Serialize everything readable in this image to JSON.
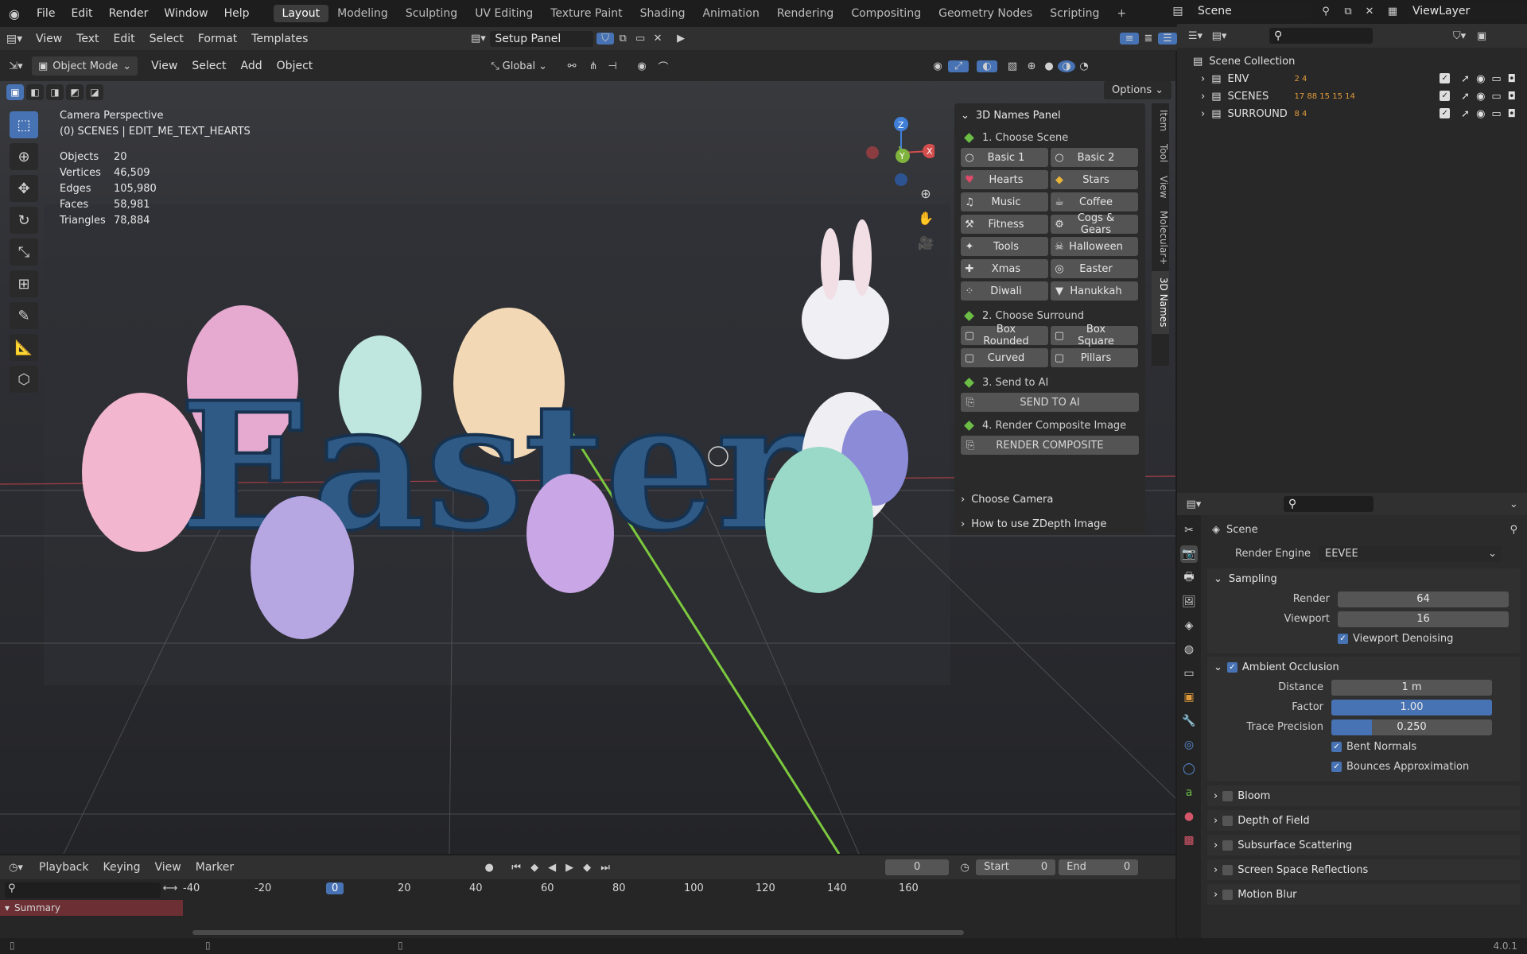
{
  "topbar": {
    "menu": [
      "File",
      "Edit",
      "Render",
      "Window",
      "Help"
    ],
    "workspaces": [
      "Layout",
      "Modeling",
      "Sculpting",
      "UV Editing",
      "Texture Paint",
      "Shading",
      "Animation",
      "Rendering",
      "Compositing",
      "Geometry Nodes",
      "Scripting"
    ],
    "active_workspace": "Layout",
    "scene": "Scene",
    "view_layer": "ViewLayer"
  },
  "text_editor": {
    "menu": [
      "View",
      "Text",
      "Edit",
      "Select",
      "Format",
      "Templates"
    ],
    "text_name": "Setup Panel"
  },
  "viewport_header": {
    "mode": "Object Mode",
    "menu": [
      "View",
      "Select",
      "Add",
      "Object"
    ],
    "transform": "Global",
    "options": "Options"
  },
  "viewport_overlay": {
    "line1": "Camera Perspective",
    "line2": "(0) SCENES | EDIT_ME_TEXT_HEARTS",
    "stats": [
      {
        "k": "Objects",
        "v": "20"
      },
      {
        "k": "Vertices",
        "v": "46,509"
      },
      {
        "k": "Edges",
        "v": "105,980"
      },
      {
        "k": "Faces",
        "v": "58,981"
      },
      {
        "k": "Triangles",
        "v": "78,884"
      }
    ]
  },
  "gizmo": {
    "z": "Z",
    "y": "Y",
    "x": "X"
  },
  "scene_text": "Easter",
  "npanel": {
    "title": "3D Names Panel",
    "step1": "1. Choose Scene",
    "scenes": [
      {
        "icon": "○",
        "label": "Basic 1"
      },
      {
        "icon": "○",
        "label": "Basic 2"
      },
      {
        "icon": "♥",
        "label": "Hearts"
      },
      {
        "icon": "◆",
        "label": "Stars"
      },
      {
        "icon": "♫",
        "label": "Music"
      },
      {
        "icon": "☕",
        "label": "Coffee"
      },
      {
        "icon": "⚒",
        "label": "Fitness"
      },
      {
        "icon": "⚙",
        "label": "Cogs & Gears"
      },
      {
        "icon": "✦",
        "label": "Tools"
      },
      {
        "icon": "☠",
        "label": "Halloween"
      },
      {
        "icon": "✚",
        "label": "Xmas"
      },
      {
        "icon": "◎",
        "label": "Easter"
      },
      {
        "icon": "⁘",
        "label": "Diwali"
      },
      {
        "icon": "▼",
        "label": "Hanukkah"
      }
    ],
    "step2": "2. Choose Surround",
    "surrounds": [
      {
        "icon": "▢",
        "label": "Box Rounded"
      },
      {
        "icon": "▢",
        "label": "Box Square"
      },
      {
        "icon": "▢",
        "label": "Curved"
      },
      {
        "icon": "▢",
        "label": "Pillars"
      }
    ],
    "step3": "3. Send to AI",
    "send": "SEND TO AI",
    "step4": "4. Render Composite Image",
    "render": "RENDER COMPOSITE",
    "choose_camera": "Choose Camera",
    "how_to": "How to use ZDepth Image"
  },
  "side_tabs": [
    "Item",
    "Tool",
    "View",
    "Molecular+",
    "3D Names"
  ],
  "outliner": {
    "root": "Scene Collection",
    "items": [
      {
        "name": "ENV",
        "badges": "2  4"
      },
      {
        "name": "SCENES",
        "badges": "17 88 15 15 14"
      },
      {
        "name": "SURROUND",
        "badges": "8 4"
      }
    ]
  },
  "properties": {
    "context": "Scene",
    "render_engine_label": "Render Engine",
    "render_engine": "EEVEE",
    "sampling": "Sampling",
    "render_label": "Render",
    "render_val": "64",
    "viewport_label": "Viewport",
    "viewport_val": "16",
    "denoise": "Viewport Denoising",
    "ao": "Ambient Occlusion",
    "distance_label": "Distance",
    "distance_val": "1 m",
    "factor_label": "Factor",
    "factor_val": "1.00",
    "factor_fill": 1.0,
    "trace_label": "Trace Precision",
    "trace_val": "0.250",
    "trace_fill": 0.25,
    "bent": "Bent Normals",
    "bounces": "Bounces Approximation",
    "panels": [
      "Bloom",
      "Depth of Field",
      "Subsurface Scattering",
      "Screen Space Reflections",
      "Motion Blur"
    ]
  },
  "timeline": {
    "menu": [
      "Playback",
      "Keying",
      "View",
      "Marker"
    ],
    "current_frame": "0",
    "start_label": "Start",
    "start": "0",
    "end_label": "End",
    "end": "0",
    "ruler": [
      "-40",
      "-20",
      "0",
      "20",
      "40",
      "60",
      "80",
      "100",
      "120",
      "140",
      "160"
    ],
    "summary": "Summary"
  },
  "status": {
    "version": "4.0.1"
  },
  "colors": {
    "accent": "#4772b3",
    "green": "#6bbd46",
    "x": "#d44e4e",
    "y": "#7fb33e",
    "z": "#3f7fd8"
  }
}
